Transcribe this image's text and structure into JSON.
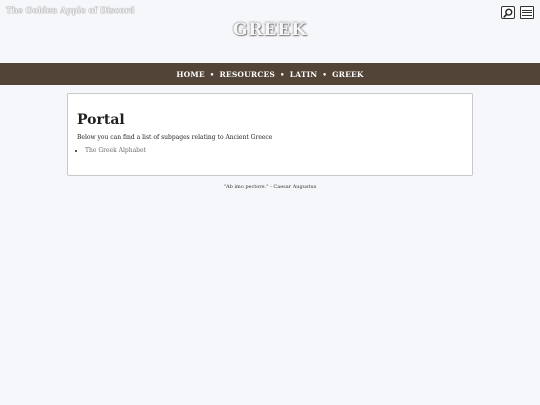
{
  "header": {
    "site_title": "The Golden Apple of Discord",
    "hero_title": "GREEK",
    "icons": [
      "search-icon",
      "hamburger-menu-icon"
    ]
  },
  "nav": {
    "items": [
      "HOME",
      "RESOURCES",
      "LATIN",
      "GREEK"
    ],
    "separator": "•"
  },
  "main": {
    "heading": "Portal",
    "intro": "Below you can find a list of subpages relating to Ancient Greece",
    "links": [
      "The Greek Alphabet"
    ]
  },
  "footer": {
    "quote": "\"Ab imo pectore.\" - Caesar Augustus"
  },
  "colors": {
    "navbar_bg": "#524538",
    "page_bg": "#f6f7fa"
  }
}
